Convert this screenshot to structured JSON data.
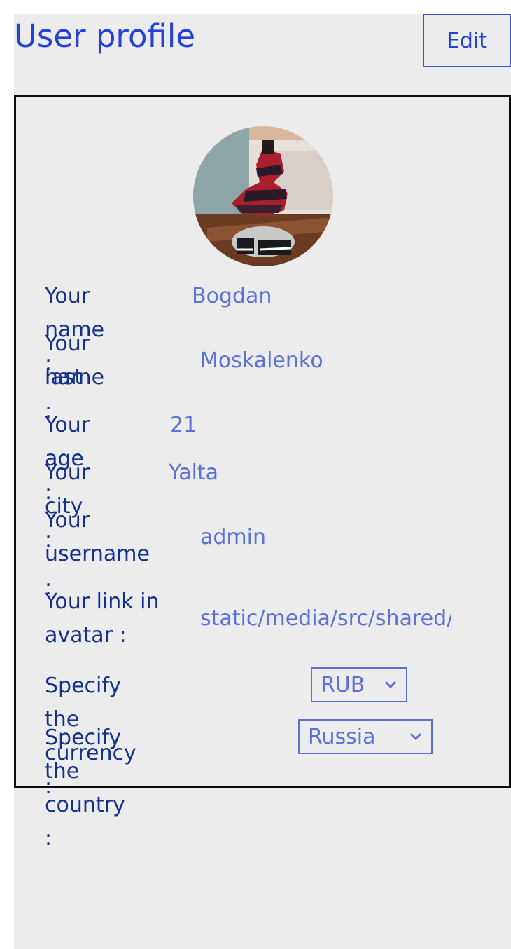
{
  "header": {
    "title": "User profile",
    "edit_label": "Edit"
  },
  "profile": {
    "name_label": "Your name :",
    "name_value": "Bogdan",
    "last_name_label_1": "Your last",
    "last_name_label_2": "name :",
    "last_name_value": "Moskalenko",
    "age_label": "Your age :",
    "age_value": "21",
    "city_label": "Your city :",
    "city_value": "Yalta",
    "username_label_1": "Your",
    "username_label_2": "username :",
    "username_value": "admin",
    "link_label_1": "Your link in",
    "link_label_2": "avatar :",
    "link_value": "static/media/src/shared/a",
    "currency_label": "Specify the currency :",
    "currency_value": "RUB",
    "country_label": "Specify the country :",
    "country_value": "Russia"
  },
  "icons": {
    "avatar": "user-avatar-photo",
    "dropdown": "chevron-down-icon"
  },
  "colors": {
    "accent": "#2541d6",
    "label": "#13318a",
    "value": "#5b71d6",
    "background": "#ececec"
  }
}
